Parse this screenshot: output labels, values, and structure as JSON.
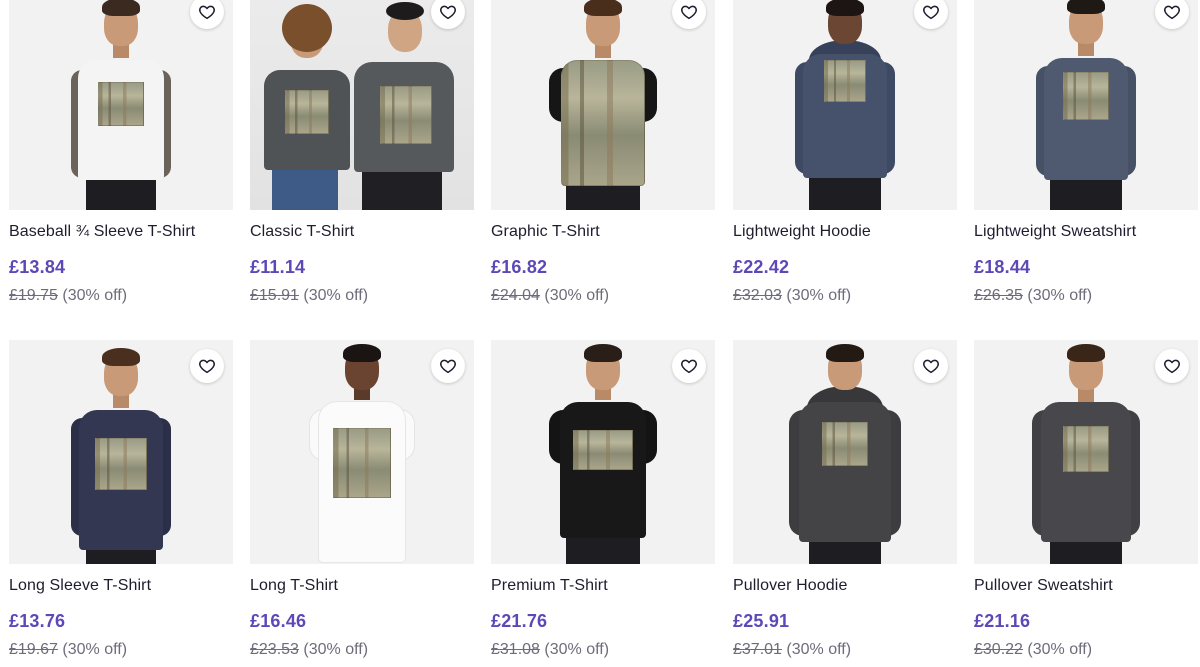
{
  "colors": {
    "price": "#5e48b8",
    "title": "#1f1c2e",
    "muted": "#6f6b7a",
    "thumb_bg": "#f2f2f2"
  },
  "icons": {
    "favorite": "heart-outline-icon"
  },
  "products": [
    {
      "title": "Baseball ¾ Sleeve T-Shirt",
      "price": "£13.84",
      "original_price": "£19.75",
      "discount": "(30% off)"
    },
    {
      "title": "Classic T-Shirt",
      "price": "£11.14",
      "original_price": "£15.91",
      "discount": "(30% off)"
    },
    {
      "title": "Graphic T-Shirt",
      "price": "£16.82",
      "original_price": "£24.04",
      "discount": "(30% off)"
    },
    {
      "title": "Lightweight Hoodie",
      "price": "£22.42",
      "original_price": "£32.03",
      "discount": "(30% off)"
    },
    {
      "title": "Lightweight Sweatshirt",
      "price": "£18.44",
      "original_price": "£26.35",
      "discount": "(30% off)"
    },
    {
      "title": "Long Sleeve T-Shirt",
      "price": "£13.76",
      "original_price": "£19.67",
      "discount": "(30% off)"
    },
    {
      "title": "Long T-Shirt",
      "price": "£16.46",
      "original_price": "£23.53",
      "discount": "(30% off)"
    },
    {
      "title": "Premium T-Shirt",
      "price": "£21.76",
      "original_price": "£31.08",
      "discount": "(30% off)"
    },
    {
      "title": "Pullover Hoodie",
      "price": "£25.91",
      "original_price": "£37.01",
      "discount": "(30% off)"
    },
    {
      "title": "Pullover Sweatshirt",
      "price": "£21.16",
      "original_price": "£30.22",
      "discount": "(30% off)"
    }
  ]
}
